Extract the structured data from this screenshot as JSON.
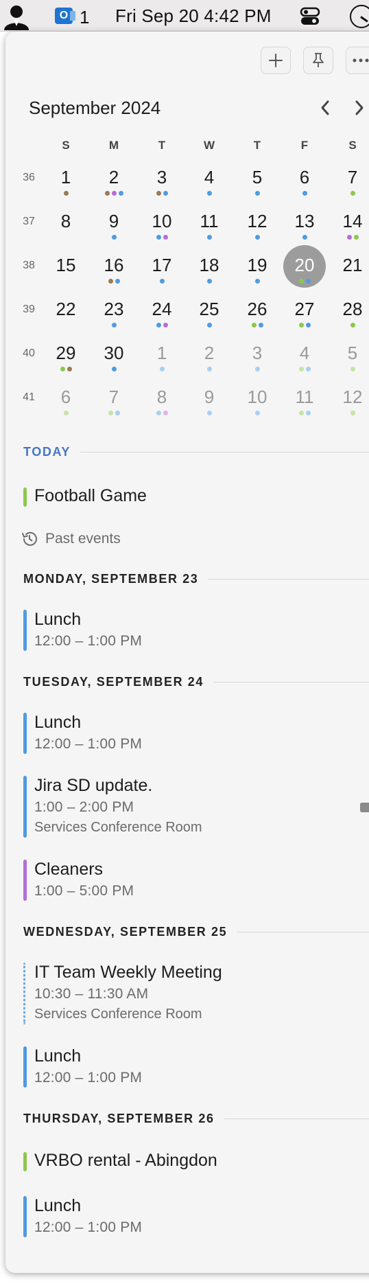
{
  "menubar": {
    "badge_count": "1",
    "datetime": "Fri Sep 20  4:42 PM",
    "outlook_letter": "O"
  },
  "toolbar": {
    "add_label": "+",
    "more_label": "···"
  },
  "calendar": {
    "month_title": "September 2024",
    "weekdays": [
      "S",
      "M",
      "T",
      "W",
      "T",
      "F",
      "S"
    ],
    "week_numbers": [
      "36",
      "37",
      "38",
      "39",
      "40",
      "41"
    ],
    "today": "20",
    "weeks": [
      [
        {
          "n": "1",
          "dots": [
            "#9a7a55"
          ]
        },
        {
          "n": "2",
          "dots": [
            "#9a7a55",
            "#b66ed6",
            "#4f9be0"
          ]
        },
        {
          "n": "3",
          "dots": [
            "#9a7a55",
            "#4f9be0"
          ]
        },
        {
          "n": "4",
          "dots": [
            "#4f9be0"
          ]
        },
        {
          "n": "5",
          "dots": [
            "#4f9be0"
          ]
        },
        {
          "n": "6",
          "dots": [
            "#4f9be0"
          ]
        },
        {
          "n": "7",
          "dots": [
            "#8cc84b"
          ]
        }
      ],
      [
        {
          "n": "8",
          "dots": []
        },
        {
          "n": "9",
          "dots": [
            "#4f9be0"
          ]
        },
        {
          "n": "10",
          "dots": [
            "#4f9be0",
            "#b66ed6"
          ]
        },
        {
          "n": "11",
          "dots": [
            "#4f9be0"
          ]
        },
        {
          "n": "12",
          "dots": [
            "#4f9be0"
          ]
        },
        {
          "n": "13",
          "dots": [
            "#4f9be0"
          ]
        },
        {
          "n": "14",
          "dots": [
            "#b66ed6",
            "#8cc84b"
          ]
        }
      ],
      [
        {
          "n": "15",
          "dots": []
        },
        {
          "n": "16",
          "dots": [
            "#9a7a55",
            "#4f9be0"
          ]
        },
        {
          "n": "17",
          "dots": [
            "#4f9be0"
          ]
        },
        {
          "n": "18",
          "dots": [
            "#4f9be0"
          ]
        },
        {
          "n": "19",
          "dots": [
            "#4f9be0"
          ]
        },
        {
          "n": "20",
          "dots": [
            "#8cc84b",
            "#4f9be0"
          ]
        },
        {
          "n": "21",
          "dots": []
        }
      ],
      [
        {
          "n": "22",
          "dots": []
        },
        {
          "n": "23",
          "dots": [
            "#4f9be0"
          ]
        },
        {
          "n": "24",
          "dots": [
            "#4f9be0",
            "#b66ed6"
          ]
        },
        {
          "n": "25",
          "dots": [
            "#4f9be0"
          ]
        },
        {
          "n": "26",
          "dots": [
            "#8cc84b",
            "#4f9be0"
          ]
        },
        {
          "n": "27",
          "dots": [
            "#8cc84b",
            "#4f9be0"
          ]
        },
        {
          "n": "28",
          "dots": [
            "#8cc84b"
          ]
        }
      ],
      [
        {
          "n": "29",
          "dots": [
            "#8cc84b",
            "#9a7a55"
          ]
        },
        {
          "n": "30",
          "dots": [
            "#4f9be0"
          ]
        },
        {
          "n": "1",
          "dots": [
            "#a9cff0"
          ],
          "other": true
        },
        {
          "n": "2",
          "dots": [
            "#a9cff0"
          ],
          "other": true
        },
        {
          "n": "3",
          "dots": [
            "#a9cff0"
          ],
          "other": true
        },
        {
          "n": "4",
          "dots": [
            "#c7e3a5",
            "#a9cff0"
          ],
          "other": true
        },
        {
          "n": "5",
          "dots": [
            "#c7e3a5"
          ],
          "other": true
        }
      ],
      [
        {
          "n": "6",
          "dots": [
            "#c7e3a5"
          ],
          "other": true
        },
        {
          "n": "7",
          "dots": [
            "#c7e3a5",
            "#a9cff0"
          ],
          "other": true
        },
        {
          "n": "8",
          "dots": [
            "#a9cff0",
            "#dcb5ea"
          ],
          "other": true
        },
        {
          "n": "9",
          "dots": [
            "#a9cff0"
          ],
          "other": true
        },
        {
          "n": "10",
          "dots": [
            "#a9cff0"
          ],
          "other": true
        },
        {
          "n": "11",
          "dots": [
            "#c7e3a5",
            "#a9cff0"
          ],
          "other": true
        },
        {
          "n": "12",
          "dots": [
            "#c7e3a5"
          ],
          "other": true
        }
      ]
    ]
  },
  "agenda": {
    "today_label": "TODAY",
    "today_event": {
      "title": "Football Game",
      "color": "#8cc84b"
    },
    "past_events_label": "Past events",
    "days": [
      {
        "heading": "MONDAY, SEPTEMBER 23",
        "events": [
          {
            "title": "Lunch",
            "time": "12:00 – 1:00 PM",
            "color": "#4f9be0"
          }
        ]
      },
      {
        "heading": "TUESDAY, SEPTEMBER 24",
        "events": [
          {
            "title": "Lunch",
            "time": "12:00 – 1:00 PM",
            "color": "#4f9be0"
          },
          {
            "title": "Jira SD update.",
            "time": "1:00 – 2:00 PM",
            "location": "Services Conference Room",
            "color": "#4f9be0",
            "video": true
          },
          {
            "title": "Cleaners",
            "time": "1:00 – 5:00 PM",
            "color": "#b66ed6"
          }
        ]
      },
      {
        "heading": "WEDNESDAY, SEPTEMBER 25",
        "events": [
          {
            "title": "IT Team Weekly Meeting",
            "time": "10:30 – 11:30 AM",
            "location": "Services Conference Room",
            "color": "#6ea8e0",
            "dashed": true
          },
          {
            "title": "Lunch",
            "time": "12:00 – 1:00 PM",
            "color": "#4f9be0"
          }
        ]
      },
      {
        "heading": "THURSDAY, SEPTEMBER 26",
        "events": [
          {
            "title": "VRBO rental - Abingdon",
            "color": "#8cc84b"
          },
          {
            "title": "Lunch",
            "time": "12:00 – 1:00 PM",
            "color": "#4f9be0"
          }
        ]
      }
    ]
  },
  "colors": {
    "accent_today": "#4478c7",
    "selected_day_fill": "#9c9c9c",
    "panel_bg": "#f5f5f5"
  },
  "icons": {
    "menubar": [
      "person-icon",
      "outlook-icon",
      "control-center-icon",
      "clock-icon"
    ],
    "toolbar": [
      "plus-icon",
      "pin-icon",
      "more-icon"
    ],
    "navigation": [
      "chevron-left-icon",
      "chevron-right-icon"
    ],
    "agenda": [
      "history-icon",
      "video-camera-icon"
    ]
  }
}
